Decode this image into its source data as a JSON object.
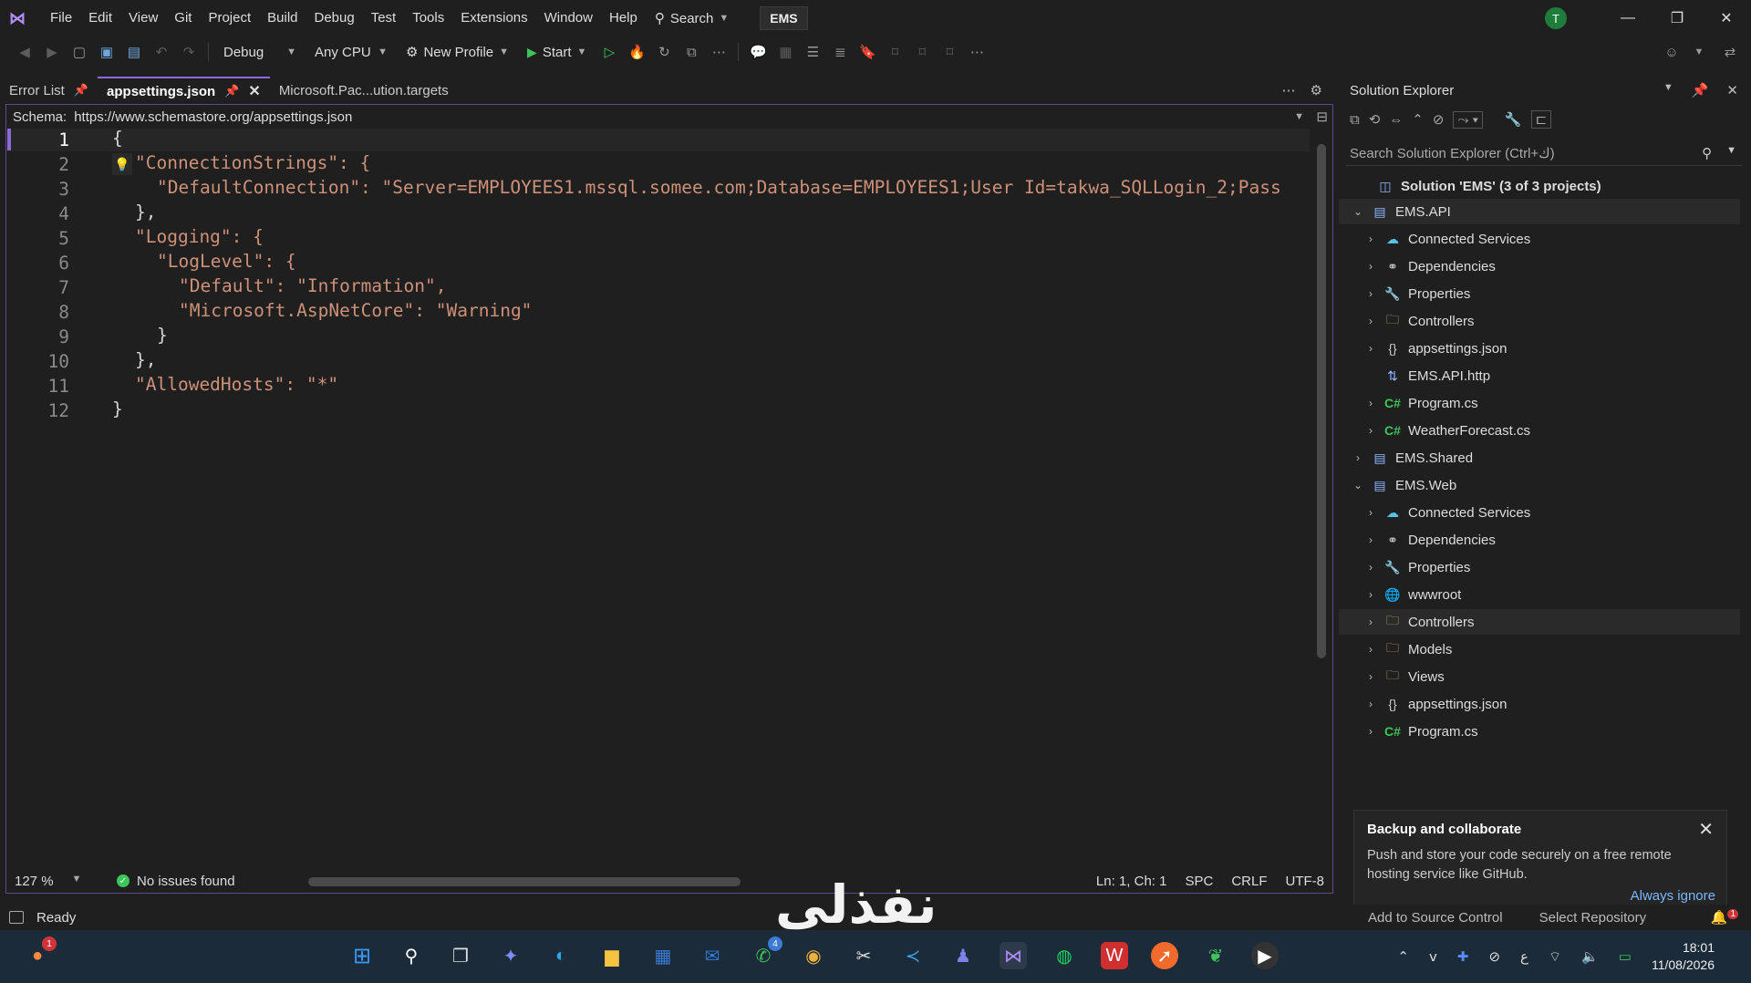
{
  "menu": {
    "items": [
      "File",
      "Edit",
      "View",
      "Git",
      "Project",
      "Build",
      "Debug",
      "Test",
      "Tools",
      "Extensions",
      "Window",
      "Help"
    ],
    "search_label": "Search",
    "solution_name": "EMS",
    "avatar_initial": "T"
  },
  "toolbar": {
    "config": "Debug",
    "platform": "Any CPU",
    "profile": "New Profile",
    "start": "Start"
  },
  "tabs": [
    {
      "label": "Error List"
    },
    {
      "label": "appsettings.json"
    },
    {
      "label": "Microsoft.Pac...ution.targets"
    }
  ],
  "schema": {
    "label": "Schema:",
    "url": "https://www.schemastore.org/appsettings.json"
  },
  "editor": {
    "lines": [
      {
        "n": "1",
        "text": "{"
      },
      {
        "n": "2",
        "text": "\"ConnectionStrings\": {"
      },
      {
        "n": "3",
        "text": "\"DefaultConnection\": \"Server=EMPLOYEES1.mssql.somee.com;Database=EMPLOYEES1;User Id=takwa_SQLLogin_2;Pass"
      },
      {
        "n": "4",
        "text": "},"
      },
      {
        "n": "5",
        "text": "\"Logging\": {"
      },
      {
        "n": "6",
        "text": "\"LogLevel\": {"
      },
      {
        "n": "7",
        "text": "\"Default\": \"Information\","
      },
      {
        "n": "8",
        "text": "\"Microsoft.AspNetCore\": \"Warning\""
      },
      {
        "n": "9",
        "text": "}"
      },
      {
        "n": "10",
        "text": "},"
      },
      {
        "n": "11",
        "text": "\"AllowedHosts\": \"*\""
      },
      {
        "n": "12",
        "text": "}"
      }
    ],
    "zoom": "127 %",
    "issues": "No issues found",
    "position": "Ln: 1, Ch: 1",
    "whitespace": "SPC",
    "line_ending": "CRLF",
    "encoding": "UTF-8"
  },
  "solution_explorer": {
    "title": "Solution Explorer",
    "search_placeholder": "Search Solution Explorer (Ctrl+ك)",
    "root": "Solution 'EMS' (3 of 3 projects)",
    "nodes": [
      {
        "label": "EMS.API",
        "icon": "project-icon"
      },
      {
        "label": "Connected Services",
        "icon": "connected-services-icon"
      },
      {
        "label": "Dependencies",
        "icon": "dependencies-icon"
      },
      {
        "label": "Properties",
        "icon": "properties-icon"
      },
      {
        "label": "Controllers",
        "icon": "folder-icon"
      },
      {
        "label": "appsettings.json",
        "icon": "json-file-icon"
      },
      {
        "label": "EMS.API.http",
        "icon": "http-file-icon"
      },
      {
        "label": "Program.cs",
        "icon": "csharp-file-icon"
      },
      {
        "label": "WeatherForecast.cs",
        "icon": "csharp-file-icon"
      },
      {
        "label": "EMS.Shared",
        "icon": "project-icon"
      },
      {
        "label": "EMS.Web",
        "icon": "project-icon"
      },
      {
        "label": "Connected Services",
        "icon": "connected-services-icon"
      },
      {
        "label": "Dependencies",
        "icon": "dependencies-icon"
      },
      {
        "label": "Properties",
        "icon": "properties-icon"
      },
      {
        "label": "wwwroot",
        "icon": "globe-icon"
      },
      {
        "label": "Controllers",
        "icon": "folder-icon"
      },
      {
        "label": "Models",
        "icon": "folder-icon"
      },
      {
        "label": "Views",
        "icon": "folder-icon"
      },
      {
        "label": "appsettings.json",
        "icon": "json-file-icon"
      },
      {
        "label": "Program.cs",
        "icon": "csharp-file-icon"
      }
    ]
  },
  "notification": {
    "title": "Backup and collaborate",
    "body": "Push and store your code securely on a free remote hosting service like GitHub.",
    "action": "Always ignore"
  },
  "statusbar": {
    "ready": "Ready",
    "add_source": "Add to Source Control",
    "select_repo": "Select Repository",
    "bell_count": "1"
  },
  "watermark": "نفذلي",
  "taskbar": {
    "firefox_badge": "1",
    "whatsapp_badge": "4",
    "time": "18:01",
    "date": "11/08/2026",
    "lang": "ع"
  },
  "colors": {
    "accent": "#8c6cdb",
    "string": "#ce9178",
    "ok": "#3ec55a",
    "link": "#7ab8ff"
  }
}
